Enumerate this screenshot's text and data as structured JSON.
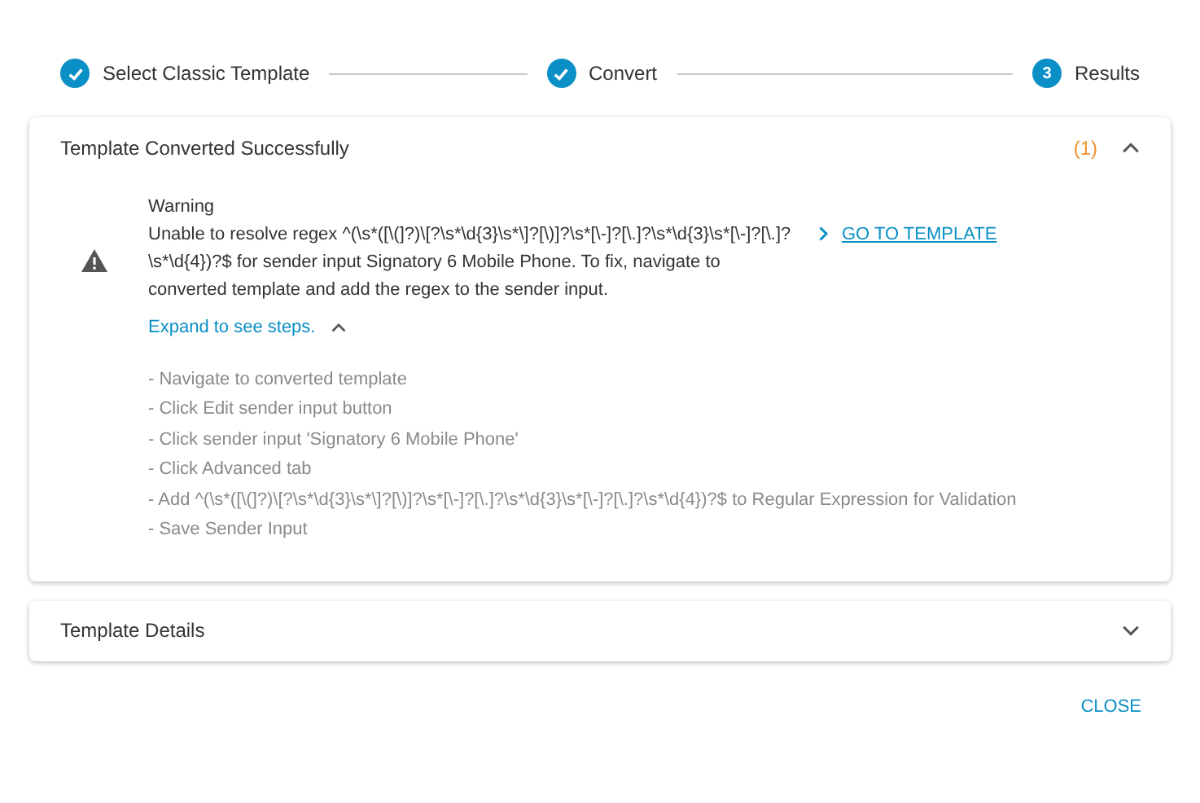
{
  "stepper": [
    {
      "label": "Select Classic Template",
      "completed": true
    },
    {
      "label": "Convert",
      "completed": true
    },
    {
      "label": "Results",
      "completed": false,
      "number": "3"
    }
  ],
  "panels": [
    {
      "title": "Template Converted Successfully",
      "count": "(1)",
      "expanded": true,
      "warning": {
        "heading": "Warning",
        "message": "Unable to resolve regex ^(\\s*([\\(]?)\\[?\\s*\\d{3}\\s*\\]?[\\)]?\\s*[\\-]?[\\.]?\\s*\\d{3}\\s*[\\-]?[\\.]?\\s*\\d{4})?$ for sender input Signatory 6 Mobile Phone. To fix, navigate to converted template and add the regex to the sender input.",
        "link": "GO TO TEMPLATE",
        "steps_toggle": {
          "label": "Expand to see steps.",
          "expanded": true
        },
        "steps": [
          "- Navigate to converted template",
          "- Click Edit sender input button",
          "- Click sender input 'Signatory 6 Mobile Phone'",
          "- Click Advanced tab",
          "- Add ^(\\s*([\\(]?)\\[?\\s*\\d{3}\\s*\\]?[\\)]?\\s*[\\-]?[\\.]?\\s*\\d{3}\\s*[\\-]?[\\.]?\\s*\\d{4})?$ to Regular Expression for Validation",
          "- Save Sender Input"
        ]
      }
    },
    {
      "title": "Template Details",
      "expanded": false
    }
  ],
  "buttons": [
    "CLOSE"
  ]
}
